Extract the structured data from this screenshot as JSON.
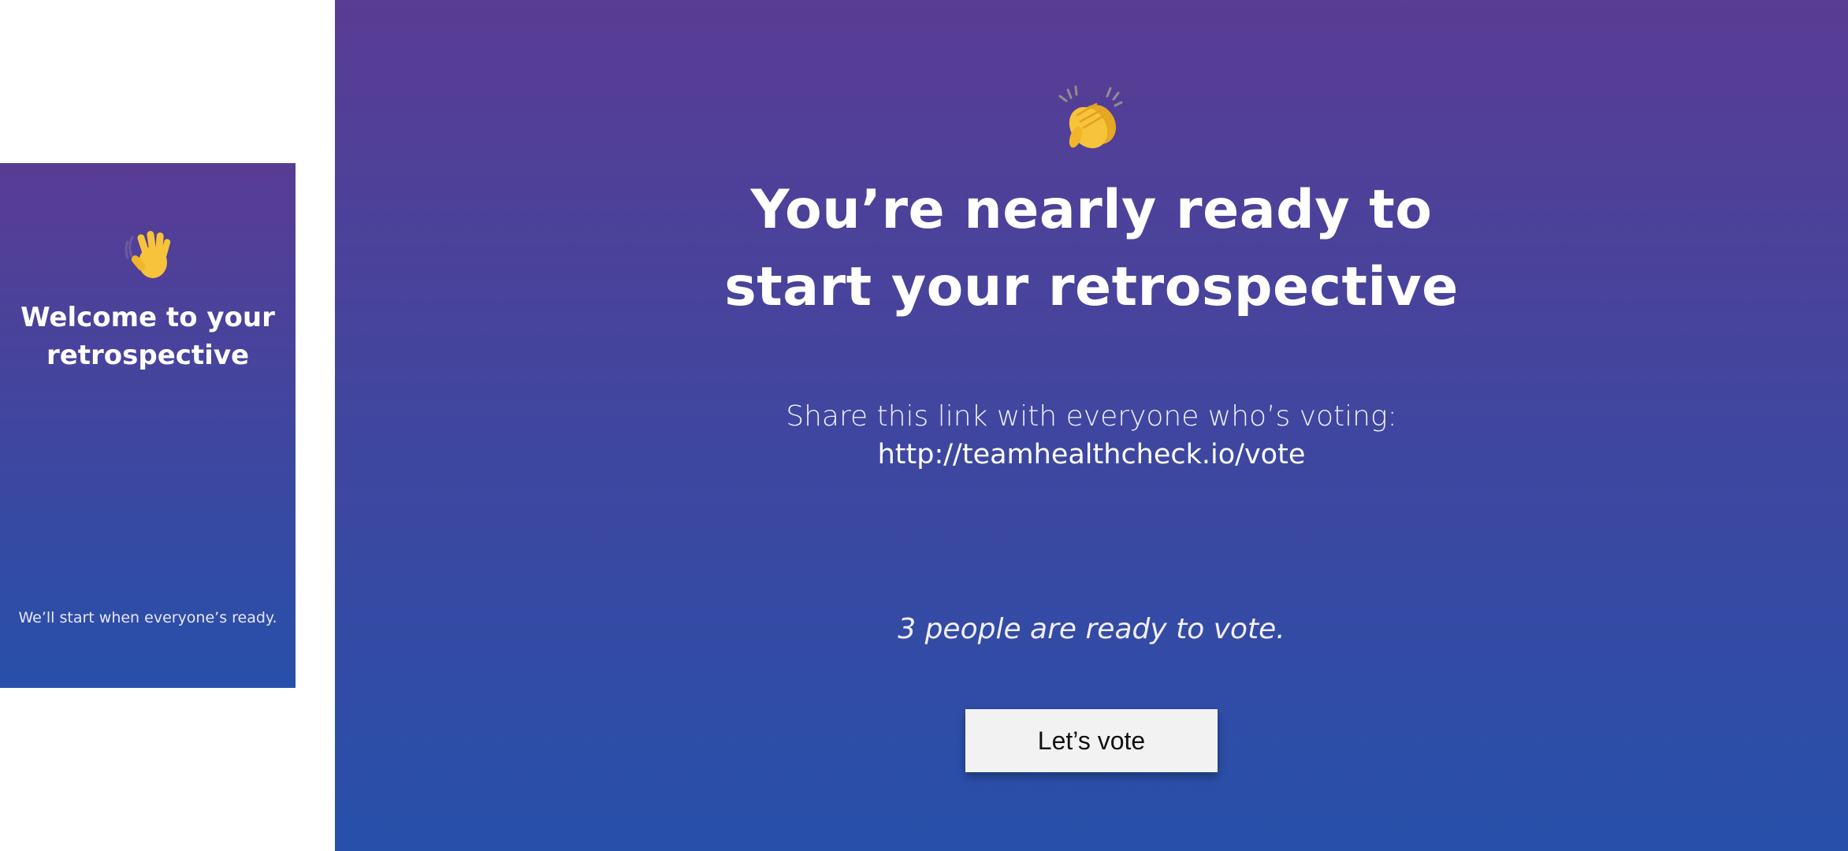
{
  "phone": {
    "icon": "waving-hand-icon",
    "title": "Welcome to your retrospective",
    "footer": "We’ll start when everyone’s ready."
  },
  "main": {
    "icon": "clapping-hands-icon",
    "heading": "You’re nearly ready to start your retrospective",
    "share_label": "Share this link with everyone who’s voting:",
    "share_link": "http://teamhealthcheck.io/vote",
    "ready_text": "3 people are ready to vote.",
    "vote_button_label": "Let’s vote"
  },
  "colors": {
    "gradient_top": "#593c94",
    "gradient_bottom": "#2750aa",
    "button_background": "#f2f2f2",
    "emoji_yellow": "#f7c33b"
  }
}
